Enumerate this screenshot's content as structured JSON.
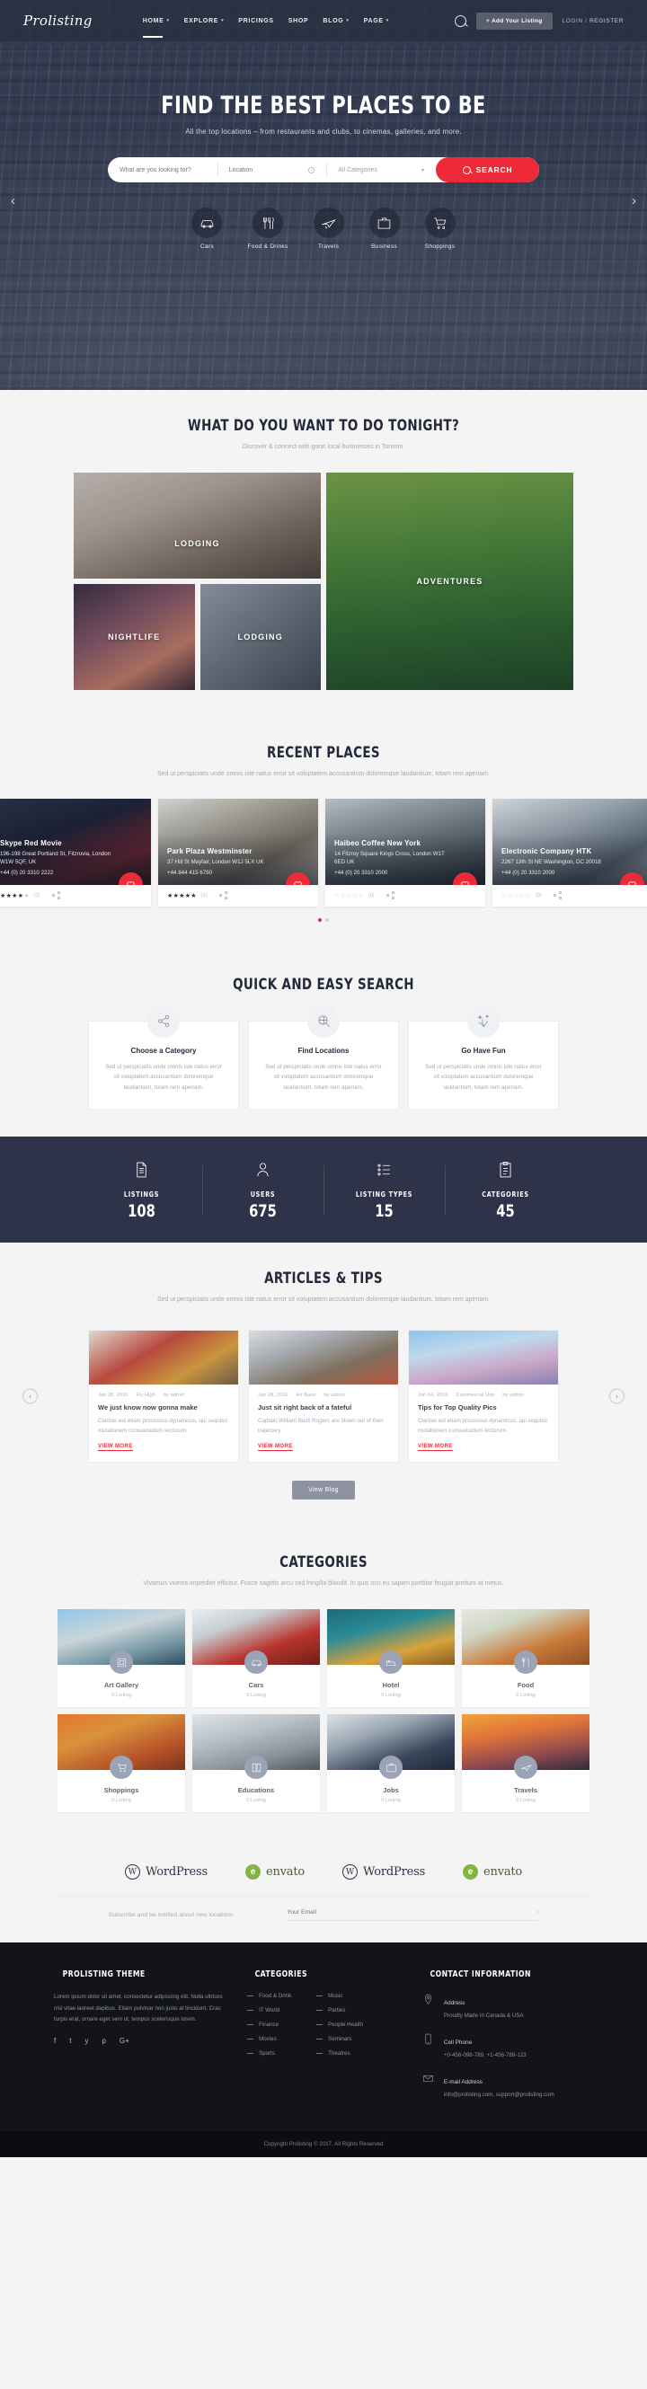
{
  "header": {
    "brand": "Prolisting",
    "nav": [
      {
        "label": "HOME",
        "caret": true,
        "active": true
      },
      {
        "label": "EXPLORE",
        "caret": true,
        "active": false
      },
      {
        "label": "PRICINGS",
        "caret": false,
        "active": false
      },
      {
        "label": "SHOP",
        "caret": false,
        "active": false
      },
      {
        "label": "BLOG",
        "caret": true,
        "active": false
      },
      {
        "label": "PAGE",
        "caret": true,
        "active": false
      }
    ],
    "search_icon": "search-icon",
    "add_listing_label": "+ Add Your Listing",
    "login_label": "LOGIN /",
    "register_label": "REGISTER"
  },
  "hero": {
    "title": "FIND THE BEST PLACES TO BE",
    "subtitle": "All the top locations – from restaurants and clubs, to cinemas, galleries, and more.",
    "search": {
      "keyword_placeholder": "What are you looking for?",
      "location_placeholder": "Location",
      "category_value": "All Categories",
      "category_caret": "▾",
      "button_label": "SEARCH"
    },
    "prev_arrow": "‹",
    "next_arrow": "›",
    "categories": [
      {
        "label": "Cars",
        "icon": "car-icon"
      },
      {
        "label": "Food & Drinks",
        "icon": "cutlery-icon"
      },
      {
        "label": "Travels",
        "icon": "plane-icon"
      },
      {
        "label": "Business",
        "icon": "briefcase-icon"
      },
      {
        "label": "Shoppings",
        "icon": "shopping-cart-icon"
      }
    ]
  },
  "tonight": {
    "title": "WHAT DO YOU WANT TO DO TONIGHT?",
    "subtitle": "Discover & connect with great local businesses in Toronto.",
    "tiles": [
      {
        "label": "LODGING"
      },
      {
        "label": "NIGHTLIFE"
      },
      {
        "label": "LODGING"
      },
      {
        "label": "ADVENTURES"
      }
    ]
  },
  "recent": {
    "title": "RECENT PLACES",
    "subtitle": "Sed ut perspiciatis unde omnis iste natus error sit voluptatem accusantium doloremque laudantium, totam rem aperiam.",
    "places": [
      {
        "name": "Skype Red Movie",
        "address": "196-198 Great Portland St, Fitzrovia, London W1W 5QF, UK",
        "phone": "+44 (0) 20 3310 2222",
        "rating": 4,
        "reviews": "(1)"
      },
      {
        "name": "Park Plaza Westminster",
        "address": "37 Hill St Mayfair, London W1J 5LX UK",
        "phone": "+44 844 415 6790",
        "rating": 5,
        "reviews": "(1)"
      },
      {
        "name": "Haibeo Coffee New York",
        "address": "14 Fitzroy Square Kings Cross, London W1T 6ED UK",
        "phone": "+44 (0) 20 3310 2000",
        "rating": 0,
        "reviews": "(0)"
      },
      {
        "name": "Electronic Company HTK",
        "address": "2267 13th St NE Washington, DC 20018",
        "phone": "+44 (0) 20 3310 2000",
        "rating": 0,
        "reviews": "(0)"
      }
    ]
  },
  "quick_search": {
    "title": "QUICK AND EASY SEARCH",
    "cards": [
      {
        "title": "Choose a Category",
        "icon": "share-nodes-icon",
        "text": "Sed ut perspiciatis unde omnis iste natus error sit voluptatem accusantium doloremque laudantium, totam rem aperiam."
      },
      {
        "title": "Find Locations",
        "icon": "magnifier-globe-icon",
        "text": "Sed ut perspiciatis unde omnis iste natus error sit voluptatem accusantium doloremque laudantium, totam rem aperiam."
      },
      {
        "title": "Go Have Fun",
        "icon": "sparkle-icon",
        "text": "Sed ut perspiciatis unde omnis iste natus error sit voluptatem accusantium doloremque laudantium, totam rem aperiam."
      }
    ]
  },
  "stats": [
    {
      "label": "LISTINGS",
      "value": "108",
      "icon": "document-list-icon"
    },
    {
      "label": "USERS",
      "value": "675",
      "icon": "user-icon"
    },
    {
      "label": "LISTING TYPES",
      "value": "15",
      "icon": "bullet-list-icon"
    },
    {
      "label": "CATEGORIES",
      "value": "45",
      "icon": "clipboard-icon"
    }
  ],
  "articles": {
    "title": "ARTICLES & TIPS",
    "subtitle": "Sed ut perspiciatis unde omnis iste natus error sit voluptatem accusantium doloremque laudantium, totam rem aperiam.",
    "prev_arrow": "‹",
    "next_arrow": "›",
    "view_blog_label": "View Blog",
    "items": [
      {
        "date": "Jan 28, 2016",
        "category": "Fly High",
        "author": "by admin",
        "title": "We just know now gonna make",
        "excerpt": "Claritas est etiam processus dynamicus, qui sequitur mutationem consuetudium lectorum.",
        "more": "VIEW MORE"
      },
      {
        "date": "Jan 28, 2016",
        "category": "Air Base",
        "author": "by admin",
        "title": "Just sit right back of a fateful",
        "excerpt": "Captain William Buck Rogers are blown out of their trajectory",
        "more": "VIEW MORE"
      },
      {
        "date": "Jun 04, 2016",
        "category": "Commercial Use",
        "author": "by admin",
        "title": "Tips for Top Quality Pics",
        "excerpt": "Claritas est etiam processus dynamicus, qui sequitur mutationem consuetudium lectorum.",
        "more": "VIEW MORE"
      }
    ]
  },
  "categories_section": {
    "title": "CATEGORIES",
    "subtitle": "Vivamus viverra imperdiet efficitur. Fusce sagittis arcu sed fringilla blandit. In quis orci eu sapien porttitor feugiat pretium at metus.",
    "items": [
      {
        "name": "Art Gallery",
        "count": "0 Listing",
        "icon": "frame-icon"
      },
      {
        "name": "Cars",
        "count": "0 Listing",
        "icon": "car-icon"
      },
      {
        "name": "Hotel",
        "count": "0 Listing",
        "icon": "bed-icon"
      },
      {
        "name": "Food",
        "count": "0 Listing",
        "icon": "cutlery-icon"
      },
      {
        "name": "Shoppings",
        "count": "0 Listing",
        "icon": "cart-icon"
      },
      {
        "name": "Educations",
        "count": "0 Listing",
        "icon": "book-icon"
      },
      {
        "name": "Jobs",
        "count": "0 Listing",
        "icon": "briefcase-icon"
      },
      {
        "name": "Travels",
        "count": "0 Listing",
        "icon": "plane-icon"
      }
    ]
  },
  "logos": [
    {
      "name": "WordPress",
      "type": "wordpress"
    },
    {
      "name": "envato",
      "type": "envato"
    },
    {
      "name": "WordPress",
      "type": "wordpress"
    },
    {
      "name": "envato",
      "type": "envato"
    }
  ],
  "newsletter": {
    "text": "Subscribe and be notified about new locations",
    "placeholder": "Your Email",
    "submit": "›"
  },
  "footer": {
    "about": {
      "title": "PROLISTING THEME",
      "text": "Lorem ipsum dolor sit amet, consectetur adipiscing elit. Nulla ultrices nisi vitae laoreet dapibus. Etiam pulvinar non justo at tincidunt. Cras turpis erat, ornare eget sem ut, tempus scelerisque lorem.",
      "social": [
        "f",
        "t",
        "y",
        "p",
        "G+"
      ]
    },
    "categories": {
      "title": "CATEGORIES",
      "col1": [
        "Food & Drink",
        "IT World",
        "Finance",
        "Movies",
        "Sports"
      ],
      "col2": [
        "Music",
        "Parties",
        "People Health",
        "Seminars",
        "Theatres"
      ]
    },
    "contact": {
      "title": "CONTACT INFORMATION",
      "items": [
        {
          "label": "Address",
          "value": "Proudly Made In Canada & USA",
          "icon": "location-pin-icon"
        },
        {
          "label": "Cell Phone",
          "value": "+0-456-098-789, +1-456-789-123",
          "icon": "mobile-phone-icon"
        },
        {
          "label": "E-mail Address",
          "value": "info@prolisting.com, support@prolisting.com",
          "icon": "envelope-icon"
        }
      ]
    },
    "copyright": "Copyright Prolisting © 2017. All Rights Reserved"
  },
  "colors": {
    "accent": "#ee2938",
    "dark": "#2e3349",
    "footer": "#121418"
  }
}
